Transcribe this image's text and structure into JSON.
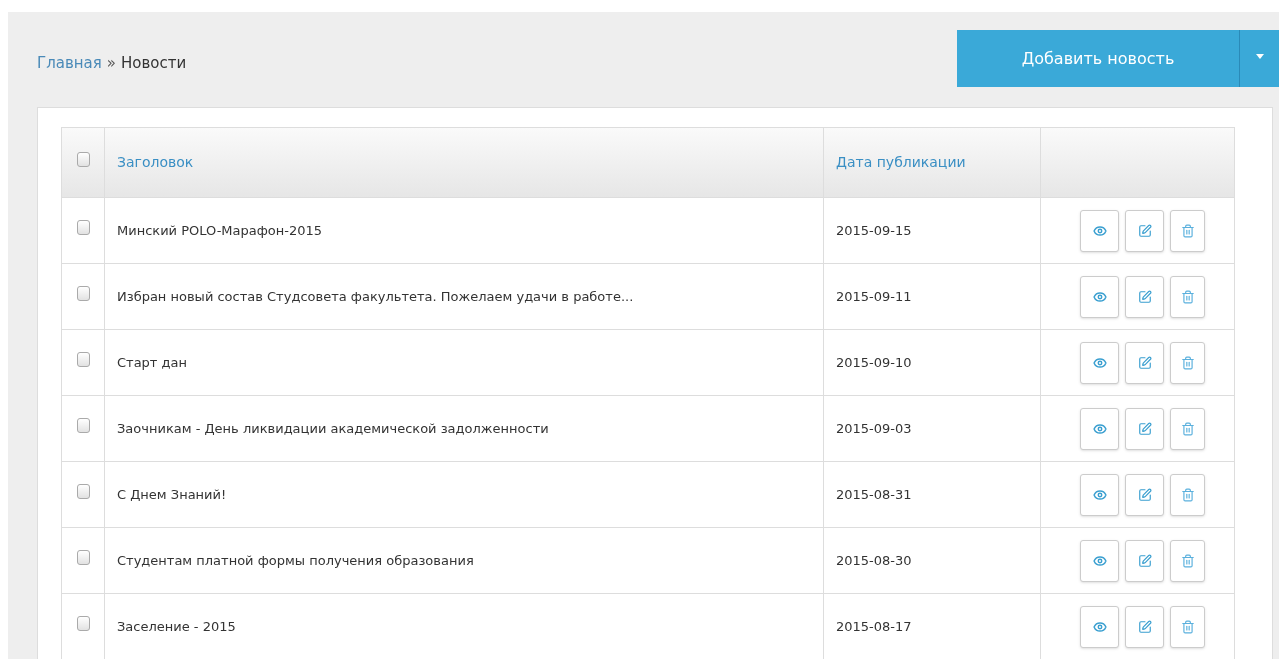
{
  "breadcrumb": {
    "link": "Главная",
    "separator": "»",
    "current": "Новости"
  },
  "add_button": {
    "label": "Добавить новость"
  },
  "table": {
    "select_all": {
      "checked": false
    },
    "columns": [
      "Заголовок",
      "Дата публикации"
    ],
    "rows": [
      {
        "checked": false,
        "title": "Минский POLO-Марафон-2015",
        "date": "2015-09-15"
      },
      {
        "checked": false,
        "title": "Избран новый состав Студсовета факультета. Пожелаем удачи в работе...",
        "date": "2015-09-11"
      },
      {
        "checked": false,
        "title": "Старт дан",
        "date": "2015-09-10"
      },
      {
        "checked": false,
        "title": "Заочникам - День ликвидации академической задолженности",
        "date": "2015-09-03"
      },
      {
        "checked": false,
        "title": "С Днем Знаний!",
        "date": "2015-08-31"
      },
      {
        "checked": false,
        "title": "Студентам платной формы получения образования",
        "date": "2015-08-30"
      },
      {
        "checked": false,
        "title": "Заселение - 2015",
        "date": "2015-08-17"
      }
    ]
  }
}
